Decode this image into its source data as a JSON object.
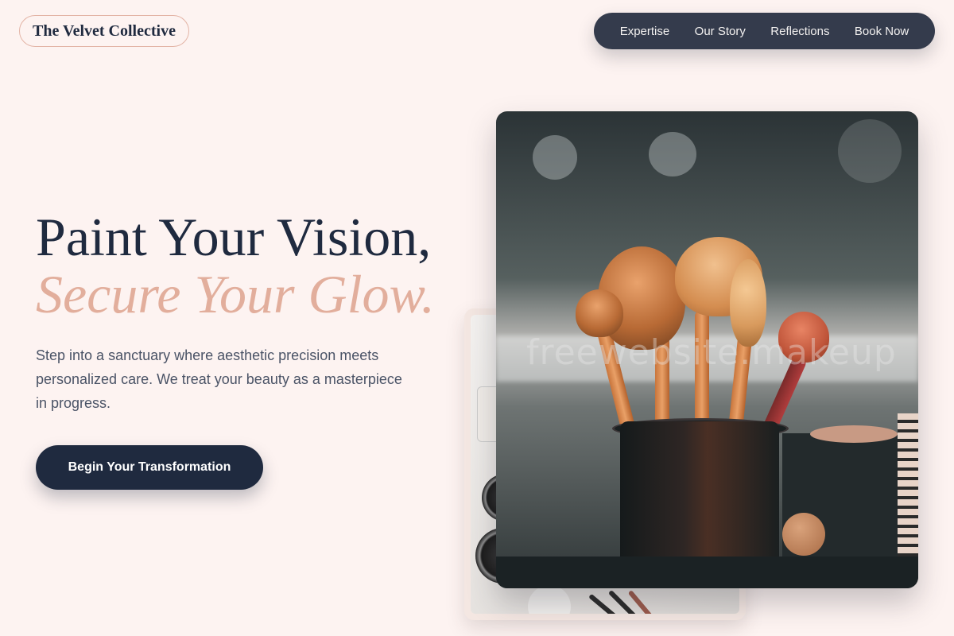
{
  "brand": {
    "name": "The Velvet Collective"
  },
  "nav": {
    "items": [
      {
        "label": "Expertise"
      },
      {
        "label": "Our Story"
      },
      {
        "label": "Reflections"
      },
      {
        "label": "Book Now"
      }
    ]
  },
  "hero": {
    "title_line1": "Paint Your Vision,",
    "title_line2": "Secure Your Glow.",
    "description": "Step into a sanctuary where aesthetic precision meets personalized care. We treat your beauty as a masterpiece in progress.",
    "cta_label": "Begin Your Transformation"
  },
  "images": {
    "front_watermark": "freewebsite.makeup"
  },
  "colors": {
    "background": "#fdf3f1",
    "navy": "#1f2a3f",
    "accent_rose": "#e2ae9c",
    "nav_bg": "#343b4c"
  }
}
